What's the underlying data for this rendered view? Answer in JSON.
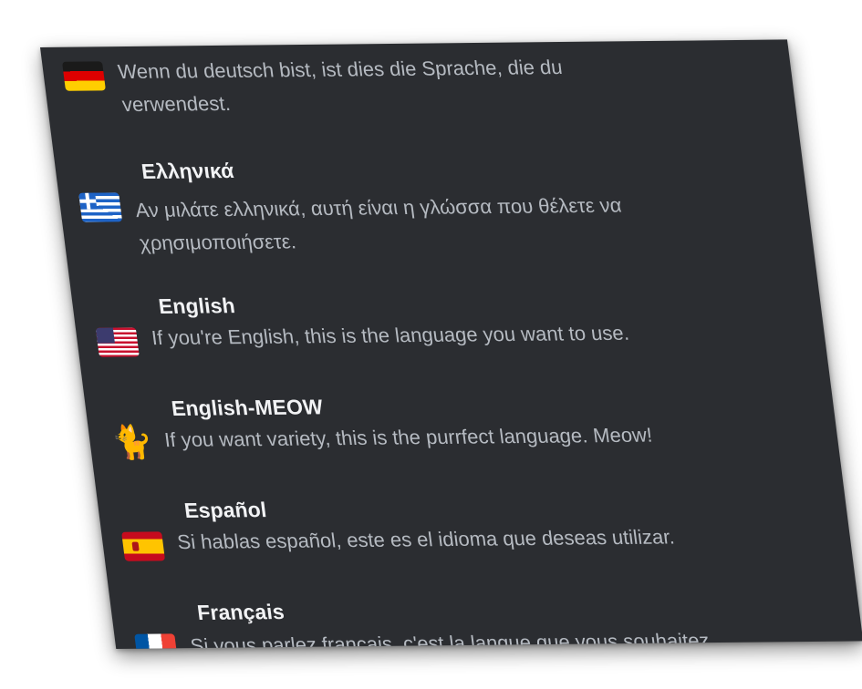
{
  "languages": [
    {
      "id": "de",
      "name": "",
      "icon": "germany-flag-icon",
      "description_line1": "Wenn du deutsch bist, ist dies die Sprache, die du",
      "description_line2": "verwendest."
    },
    {
      "id": "el",
      "name": "Ελληνικά",
      "icon": "greece-flag-icon",
      "description_line1": "Αν μιλάτε ελληνικά, αυτή είναι η γλώσσα που θέλετε να",
      "description_line2": "χρησιμοποιήσετε."
    },
    {
      "id": "en",
      "name": "English",
      "icon": "usa-flag-icon",
      "description_line1": "If you're English, this is the language you want to use.",
      "description_line2": ""
    },
    {
      "id": "en-meow",
      "name": "English-MEOW",
      "icon": "cat-icon",
      "description_line1": "If you want variety, this is the purrfect language. Meow!",
      "description_line2": ""
    },
    {
      "id": "es",
      "name": "Español",
      "icon": "spain-flag-icon",
      "description_line1": "Si hablas español, este es el idioma que deseas utilizar.",
      "description_line2": ""
    },
    {
      "id": "fr",
      "name": "Français",
      "icon": "france-flag-icon",
      "description_line1": "Si vous parlez français, c'est la langue que vous souhaitez",
      "description_line2": ""
    }
  ],
  "colors": {
    "panel_background": "#2b2d31",
    "name_text": "#f2f3f5",
    "description_text": "#b5bac1"
  }
}
